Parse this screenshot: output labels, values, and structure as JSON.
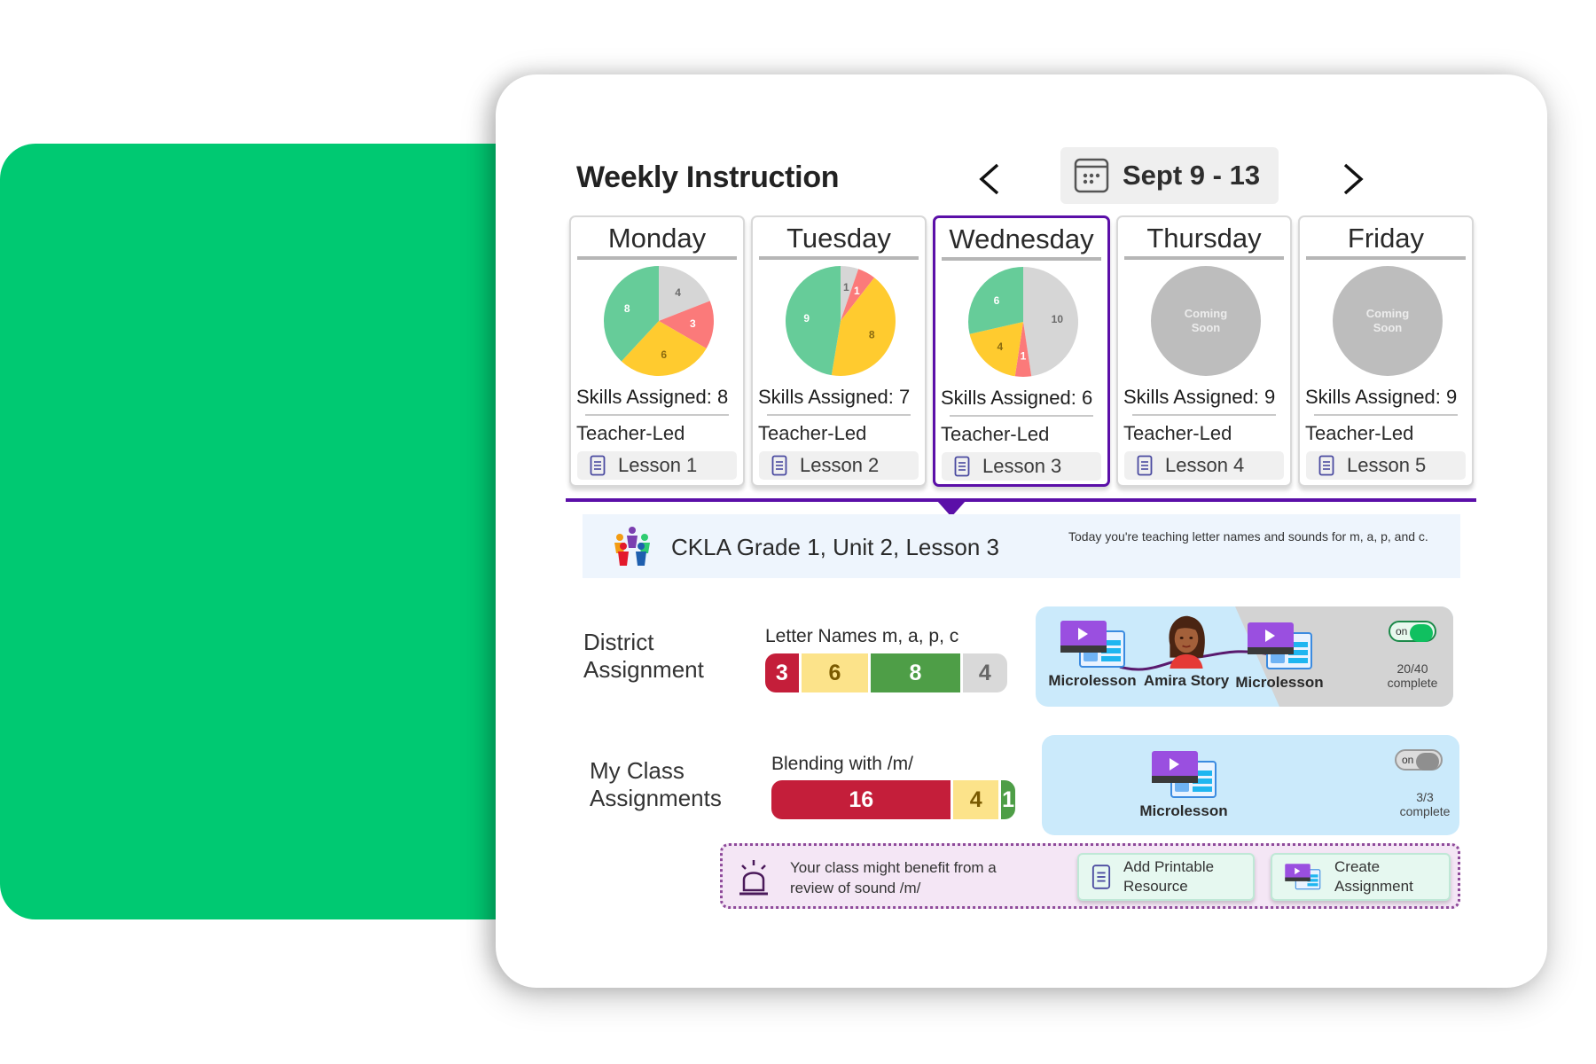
{
  "header": {
    "title": "Weekly Instruction",
    "prev_icon": "chevron-left-icon",
    "next_icon": "chevron-right-icon",
    "date_range": "Sept 9 - 13",
    "calendar_icon": "calendar-icon"
  },
  "colors": {
    "accent_purple": "#5b0fa8",
    "brand_green": "#00c972",
    "pie_green": "#66cc99",
    "pie_gray": "#d6d6d6",
    "pie_red": "#fb7a7a",
    "pie_yellow": "#ffcb2f",
    "coming_soon_gray": "#bdbdbd",
    "bar_red": "#c41e3a",
    "bar_yellow": "#fce38a",
    "bar_green": "#4e9e47",
    "bar_gray": "#d9d9d9"
  },
  "days": [
    {
      "name": "Monday",
      "skills_label": "Skills Assigned: 8",
      "mode": "Teacher-Led",
      "lesson": "Lesson 1",
      "active": false,
      "coming_soon": false,
      "pie": [
        {
          "label": "gray",
          "value": 4
        },
        {
          "label": "red",
          "value": 3
        },
        {
          "label": "yellow",
          "value": 6
        },
        {
          "label": "green",
          "value": 8
        }
      ]
    },
    {
      "name": "Tuesday",
      "skills_label": "Skills Assigned: 7",
      "mode": "Teacher-Led",
      "lesson": "Lesson 2",
      "active": false,
      "coming_soon": false,
      "pie": [
        {
          "label": "gray",
          "value": 1
        },
        {
          "label": "red",
          "value": 1
        },
        {
          "label": "yellow",
          "value": 8
        },
        {
          "label": "green",
          "value": 9
        }
      ]
    },
    {
      "name": "Wednesday",
      "skills_label": "Skills Assigned: 6",
      "mode": "Teacher-Led",
      "lesson": "Lesson 3",
      "active": true,
      "coming_soon": false,
      "pie": [
        {
          "label": "gray",
          "value": 10
        },
        {
          "label": "red",
          "value": 1
        },
        {
          "label": "yellow",
          "value": 4
        },
        {
          "label": "green",
          "value": 6
        }
      ]
    },
    {
      "name": "Thursday",
      "skills_label": "Skills Assigned: 9",
      "mode": "Teacher-Led",
      "lesson": "Lesson 4",
      "active": false,
      "coming_soon": true,
      "coming_soon_text": "Coming Soon",
      "pie": []
    },
    {
      "name": "Friday",
      "skills_label": "Skills Assigned: 9",
      "mode": "Teacher-Led",
      "lesson": "Lesson 5",
      "active": false,
      "coming_soon": true,
      "coming_soon_text": "Coming Soon",
      "pie": []
    }
  ],
  "banner": {
    "logo_icon": "ckla-people-logo-icon",
    "title": "CKLA Grade 1, Unit 2, Lesson 3",
    "description": "Today you're teaching letter names and sounds for m, a, p, and c."
  },
  "district": {
    "label_line1": "District",
    "label_line2": "Assignment",
    "bar_title": "Letter Names m, a, p, c",
    "segments": [
      {
        "color": "red",
        "value": 3
      },
      {
        "color": "yellow",
        "value": 6
      },
      {
        "color": "green",
        "value": 8
      },
      {
        "color": "gray",
        "value": 4
      }
    ],
    "path": [
      {
        "type": "microlesson",
        "label": "Microlesson",
        "icon": "microlesson-video-icon"
      },
      {
        "type": "story",
        "label": "Amira Story",
        "icon": "amira-avatar-icon"
      },
      {
        "type": "microlesson",
        "label": "Microlesson",
        "icon": "microlesson-video-icon"
      }
    ],
    "toggle_label": "on",
    "toggle_on": true,
    "progress_count": "20/40",
    "progress_label": "complete",
    "progress_fraction": 0.5
  },
  "my_class": {
    "label_line1": "My Class",
    "label_line2": "Assignments",
    "bar_title": "Blending with /m/",
    "segments": [
      {
        "color": "red",
        "value": 16
      },
      {
        "color": "yellow",
        "value": 4
      },
      {
        "color": "green",
        "value": 1
      }
    ],
    "path": [
      {
        "type": "microlesson",
        "label": "Microlesson",
        "icon": "microlesson-video-icon"
      }
    ],
    "toggle_label": "on",
    "toggle_on": false,
    "progress_count": "3/3",
    "progress_label": "complete",
    "progress_fraction": 1.0
  },
  "recommendation": {
    "icon": "alert-siren-icon",
    "text": "Your class might benefit from a review of sound /m/",
    "buttons": [
      {
        "label_line1": "Add Printable",
        "label_line2": "Resource",
        "icon": "document-icon"
      },
      {
        "label_line1": "Create",
        "label_line2": "Assignment",
        "icon": "microlesson-video-icon"
      }
    ]
  }
}
